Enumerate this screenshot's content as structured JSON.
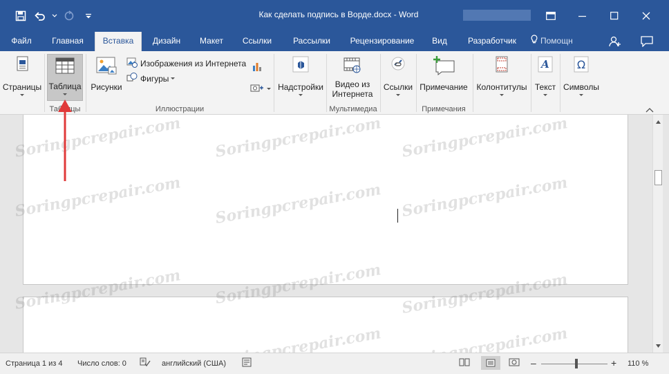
{
  "window": {
    "title": "Как сделать подпись в Ворде.docx - Word"
  },
  "tabs": {
    "file": "Файл",
    "home": "Главная",
    "insert": "Вставка",
    "design": "Дизайн",
    "layout": "Макет",
    "references": "Ссылки",
    "mailings": "Рассылки",
    "review": "Рецензирование",
    "view": "Вид",
    "developer": "Разработчик",
    "help": "Помощн"
  },
  "ribbon": {
    "pages": "Страницы",
    "table": "Таблица",
    "pictures": "Рисунки",
    "online_pictures": "Изображения из Интернета",
    "shapes": "Фигуры",
    "addins": "Надстройки",
    "video_line1": "Видео из",
    "video_line2": "Интернета",
    "links": "Ссылки",
    "comment": "Примечание",
    "header_footer": "Колонтитулы",
    "text": "Текст",
    "symbols": "Символы",
    "groups": {
      "tables": "Таблицы",
      "illustrations": "Иллюстрации",
      "media": "Мультимедиа",
      "comments": "Примечания"
    }
  },
  "watermark": "Soringpcrepair.com",
  "status": {
    "page": "Страница 1 из 4",
    "words": "Число слов: 0",
    "language": "английский (США)",
    "zoom_minus": "–",
    "zoom_plus": "+",
    "zoom": "110 %",
    "zoom_level_fraction": 0.53
  },
  "colors": {
    "brand": "#2b579a",
    "arrow": "#e03a3a"
  }
}
